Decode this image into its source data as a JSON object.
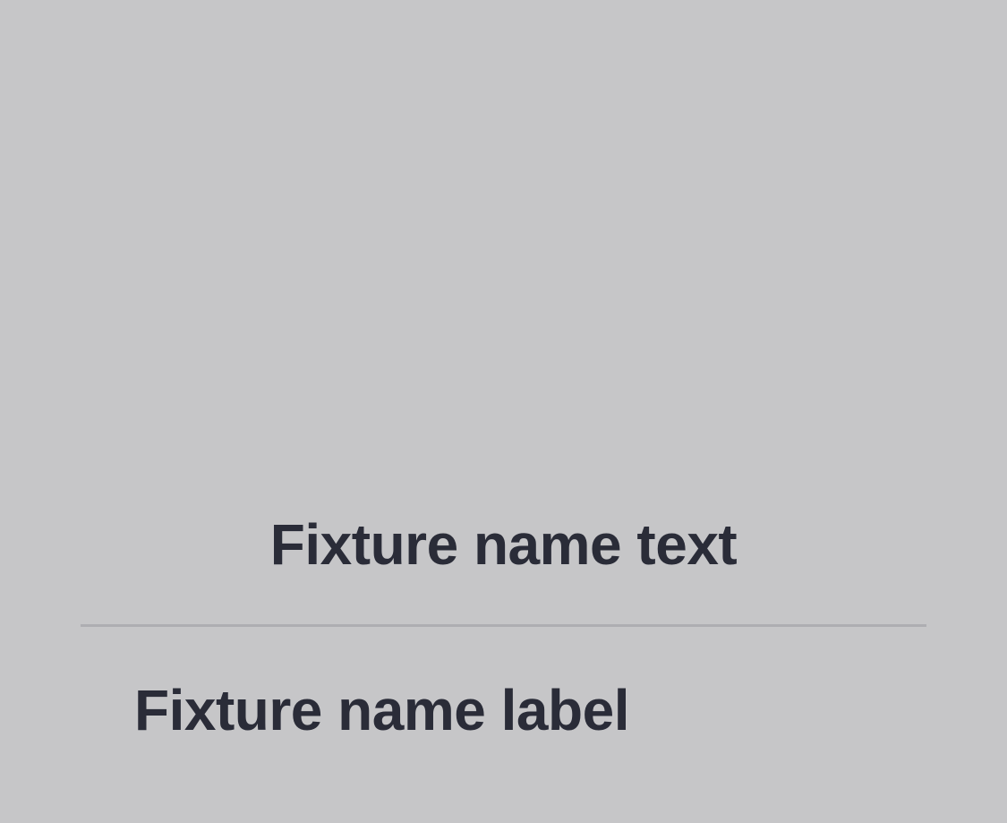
{
  "fixture": {
    "name_text": "Fixture name text",
    "name_label": "Fixture name label"
  },
  "colors": {
    "background": "#c6c6c8",
    "text": "#2a2c38",
    "divider": "#aeaeb2"
  }
}
